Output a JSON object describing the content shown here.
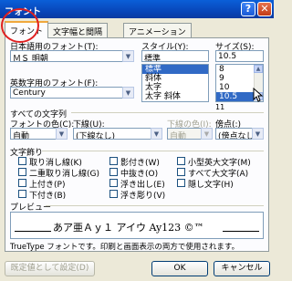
{
  "window": {
    "title": "フォント",
    "help": "?",
    "close": "✕"
  },
  "tabs": [
    {
      "label": "フォント"
    },
    {
      "label": "文字幅と間隔"
    },
    {
      "label": "アニメーション"
    }
  ],
  "jp_font": {
    "label": "日本語用のフォント(T):",
    "value": "ＭＳ 明朝"
  },
  "style": {
    "label": "スタイル(Y):",
    "value": "標準",
    "options": [
      "標準",
      "斜体",
      "太字",
      "太字 斜体"
    ],
    "selected": "標準"
  },
  "size": {
    "label": "サイズ(S):",
    "value": "10.5",
    "options": [
      "8",
      "9",
      "10",
      "10.5",
      "11"
    ],
    "selected": "10.5"
  },
  "en_font": {
    "label": "英数字用のフォント(F):",
    "value": "Century"
  },
  "all_text": {
    "section_label": "すべての文字列",
    "font_color": {
      "label": "フォントの色(C):",
      "value": "自動"
    },
    "underline": {
      "label": "下線(U):",
      "value": "(下線なし)"
    },
    "underline_color": {
      "label": "下線の色(I):",
      "value": "自動"
    },
    "emphasis": {
      "label": "傍点(:)",
      "value": "(傍点なし)"
    }
  },
  "effects": {
    "section_label": "文字飾り",
    "items": [
      {
        "label": "取り消し線(K)",
        "checked": false
      },
      {
        "label": "影付き(W)",
        "checked": false
      },
      {
        "label": "小型英大文字(M)",
        "checked": false
      },
      {
        "label": "二重取り消し線(G)",
        "checked": false
      },
      {
        "label": "中抜き(O)",
        "checked": false
      },
      {
        "label": "すべて大文字(A)",
        "checked": false
      },
      {
        "label": "上付き(P)",
        "checked": false
      },
      {
        "label": "浮き出し(E)",
        "checked": false
      },
      {
        "label": "隠し文字(H)",
        "checked": false
      },
      {
        "label": "下付き(B)",
        "checked": false
      },
      {
        "label": "浮き彫り(V)",
        "checked": false
      }
    ]
  },
  "preview": {
    "label": "プレビュー",
    "sample": "あア亜Ａｙ１ アイウ Ay123 ©™",
    "note": "TrueType フォントです。印刷と画面表示の両方で使用されます。"
  },
  "buttons": {
    "default": "既定値として設定(D)",
    "ok": "OK",
    "cancel": "キャンセル"
  }
}
